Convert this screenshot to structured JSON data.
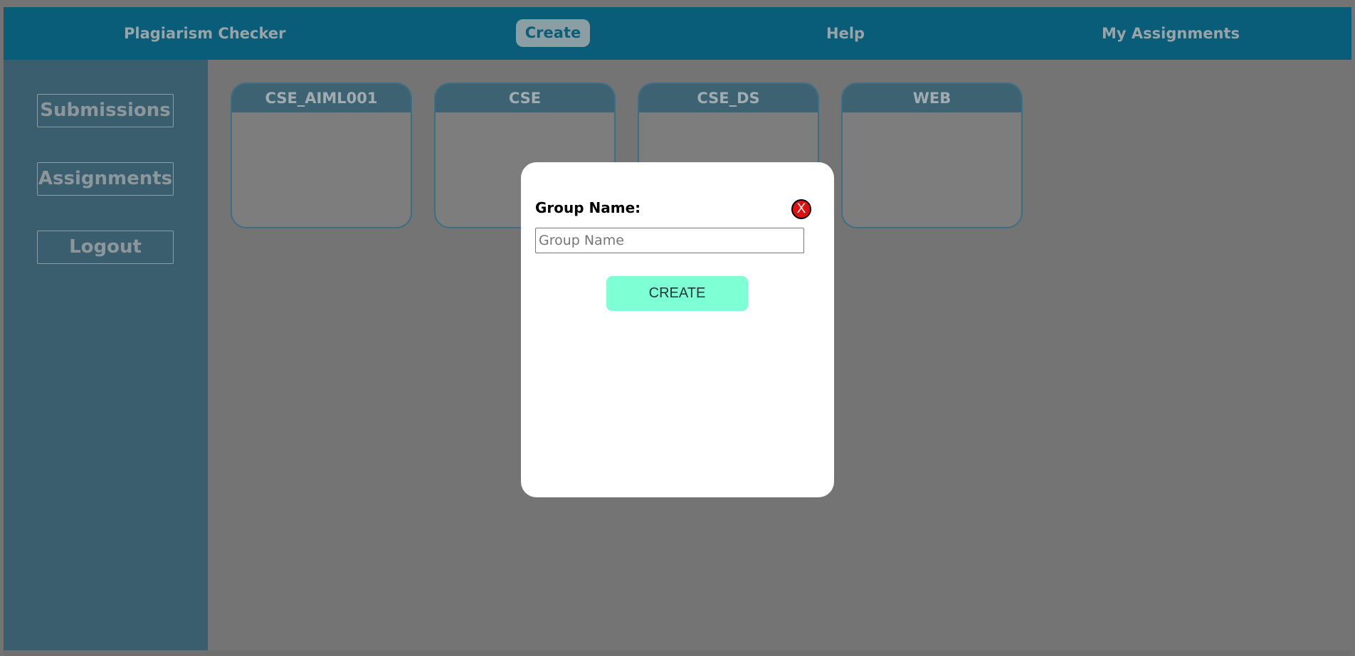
{
  "nav": {
    "app_title": "Plagiarism Checker",
    "create": "Create",
    "help": "Help",
    "my_assignments": "My Assignments"
  },
  "sidebar": {
    "items": [
      {
        "label": "Submissions"
      },
      {
        "label": "Assignments"
      },
      {
        "label": "Logout"
      }
    ]
  },
  "groups": [
    {
      "name": "CSE_AIML001"
    },
    {
      "name": "CSE"
    },
    {
      "name": "CSE_DS"
    },
    {
      "name": "WEB"
    }
  ],
  "modal": {
    "label": "Group Name:",
    "input_value": "",
    "input_placeholder": "Group Name",
    "create_label": "CREATE",
    "close_label": "X"
  },
  "colors": {
    "topbar": "#0a5d79",
    "sidebar": "#3b5e6e",
    "create_button": "#7fffd4",
    "close_button": "#e01010"
  },
  "icons": {
    "close": "close-icon"
  }
}
